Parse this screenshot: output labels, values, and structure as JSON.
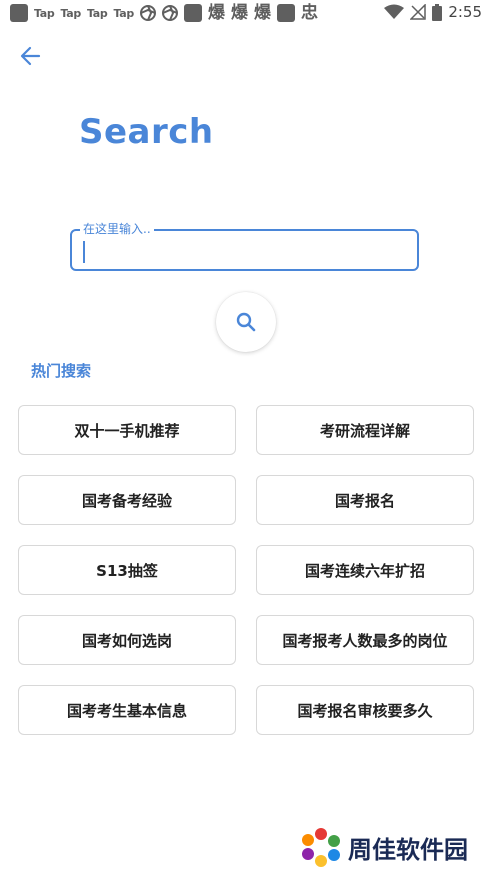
{
  "status_bar": {
    "tap_labels": [
      "Tap",
      "Tap",
      "Tap",
      "Tap"
    ],
    "glyphs": [
      "爆",
      "爆",
      "爆",
      "忠"
    ],
    "time": "2:55"
  },
  "header": {
    "title": "Search"
  },
  "search": {
    "label": "在这里输入..",
    "value": ""
  },
  "hot": {
    "label": "热门搜索",
    "items": [
      "双十一手机推荐",
      "考研流程详解",
      "国考备考经验",
      "国考报名",
      "S13抽签",
      "国考连续六年扩招",
      "国考如何选岗",
      "国考报考人数最多的岗位",
      "国考考生基本信息",
      "国考报名审核要多久"
    ]
  },
  "watermark": {
    "text": "周佳软件园"
  },
  "colors": {
    "accent": "#4a86d8",
    "chip_border": "#d8d8d8",
    "status_icons": "#5f5f5f"
  }
}
